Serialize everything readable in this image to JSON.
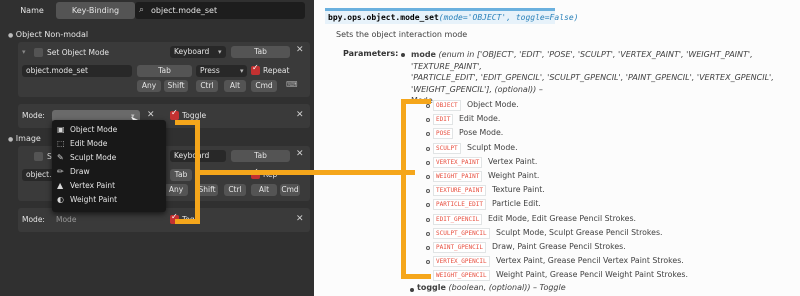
{
  "colors": {
    "accent_orange": "#f5a61b",
    "check_red": "#c33131",
    "doc_link": "#2980b9",
    "code_red": "#e74c3c"
  },
  "keymap": {
    "header": {
      "name_label": "Name",
      "keybinding_tab": "Key-Binding",
      "search_value": "object.mode_set"
    },
    "section1": {
      "title": "Object Non-modal",
      "item_name": "Set Object Mode",
      "device": "Keyboard",
      "key": "Tab",
      "operator_id": "object.mode_set",
      "key_field": "Tab",
      "event": "Press",
      "repeat_label": "Repeat",
      "modifiers": [
        "Any",
        "Shift",
        "Ctrl",
        "Alt",
        "Cmd"
      ],
      "mode_label": "Mode:",
      "toggle_label": "Toggle"
    },
    "section2": {
      "title": "Image",
      "item_name_partial": "S",
      "device": "Keyboard",
      "key": "Tab",
      "operator_partial": "object.m",
      "key_field": "Tab",
      "repeat_label": "Repeat",
      "modifiers": [
        "Any",
        "Shift",
        "Ctrl",
        "Alt",
        "Cmd"
      ],
      "mode_label": "Mode:",
      "mode_placeholder": "Mode",
      "toggle_partial": "Togg"
    },
    "popup_items": [
      {
        "label": "Object Mode",
        "icon": "object-mode-icon",
        "glyph": "▣"
      },
      {
        "label": "Edit Mode",
        "icon": "edit-mode-icon",
        "glyph": "⬚"
      },
      {
        "label": "Sculpt Mode",
        "icon": "sculpt-mode-icon",
        "glyph": "✎"
      },
      {
        "label": "Draw",
        "icon": "draw-icon",
        "glyph": "✏"
      },
      {
        "label": "Vertex Paint",
        "icon": "vertex-paint-icon",
        "glyph": "▲"
      },
      {
        "label": "Weight Paint",
        "icon": "weight-paint-icon",
        "glyph": "◐"
      }
    ]
  },
  "doc": {
    "signature_name": "bpy.ops.object.mode_set",
    "signature_args": "(mode='OBJECT', toggle=False)",
    "summary": "Sets the object interaction mode",
    "params_label": "Parameters:",
    "mode_param": "mode",
    "mode_type_line1": " (enum in ['OBJECT', 'EDIT', 'POSE', 'SCULPT', 'VERTEX_PAINT', 'WEIGHT_PAINT', 'TEXTURE_PAINT',",
    "mode_type_line2": "'PARTICLE_EDIT', 'EDIT_GPENCIL', 'SCULPT_GPENCIL', 'PAINT_GPENCIL', 'VERTEX_GPENCIL',",
    "mode_type_line3": "'WEIGHT_GPENCIL'], (optional)) –",
    "mode_desc": "Mode",
    "enum_items": [
      {
        "code": "OBJECT",
        "desc": "Object Mode."
      },
      {
        "code": "EDIT",
        "desc": "Edit Mode."
      },
      {
        "code": "POSE",
        "desc": "Pose Mode."
      },
      {
        "code": "SCULPT",
        "desc": "Sculpt Mode."
      },
      {
        "code": "VERTEX_PAINT",
        "desc": "Vertex Paint."
      },
      {
        "code": "WEIGHT_PAINT",
        "desc": "Weight Paint."
      },
      {
        "code": "TEXTURE_PAINT",
        "desc": "Texture Paint."
      },
      {
        "code": "PARTICLE_EDIT",
        "desc": "Particle Edit."
      },
      {
        "code": "EDIT_GPENCIL",
        "desc": "Edit Mode, Edit Grease Pencil Strokes."
      },
      {
        "code": "SCULPT_GPENCIL",
        "desc": "Sculpt Mode, Sculpt Grease Pencil Strokes."
      },
      {
        "code": "PAINT_GPENCIL",
        "desc": "Draw, Paint Grease Pencil Strokes."
      },
      {
        "code": "VERTEX_GPENCIL",
        "desc": "Vertex Paint, Grease Pencil Vertex Paint Strokes."
      },
      {
        "code": "WEIGHT_GPENCIL",
        "desc": "Weight Paint, Grease Pencil Weight Paint Strokes."
      }
    ],
    "toggle_param": "toggle",
    "toggle_type": " (boolean, (optional)) – Toggle"
  }
}
